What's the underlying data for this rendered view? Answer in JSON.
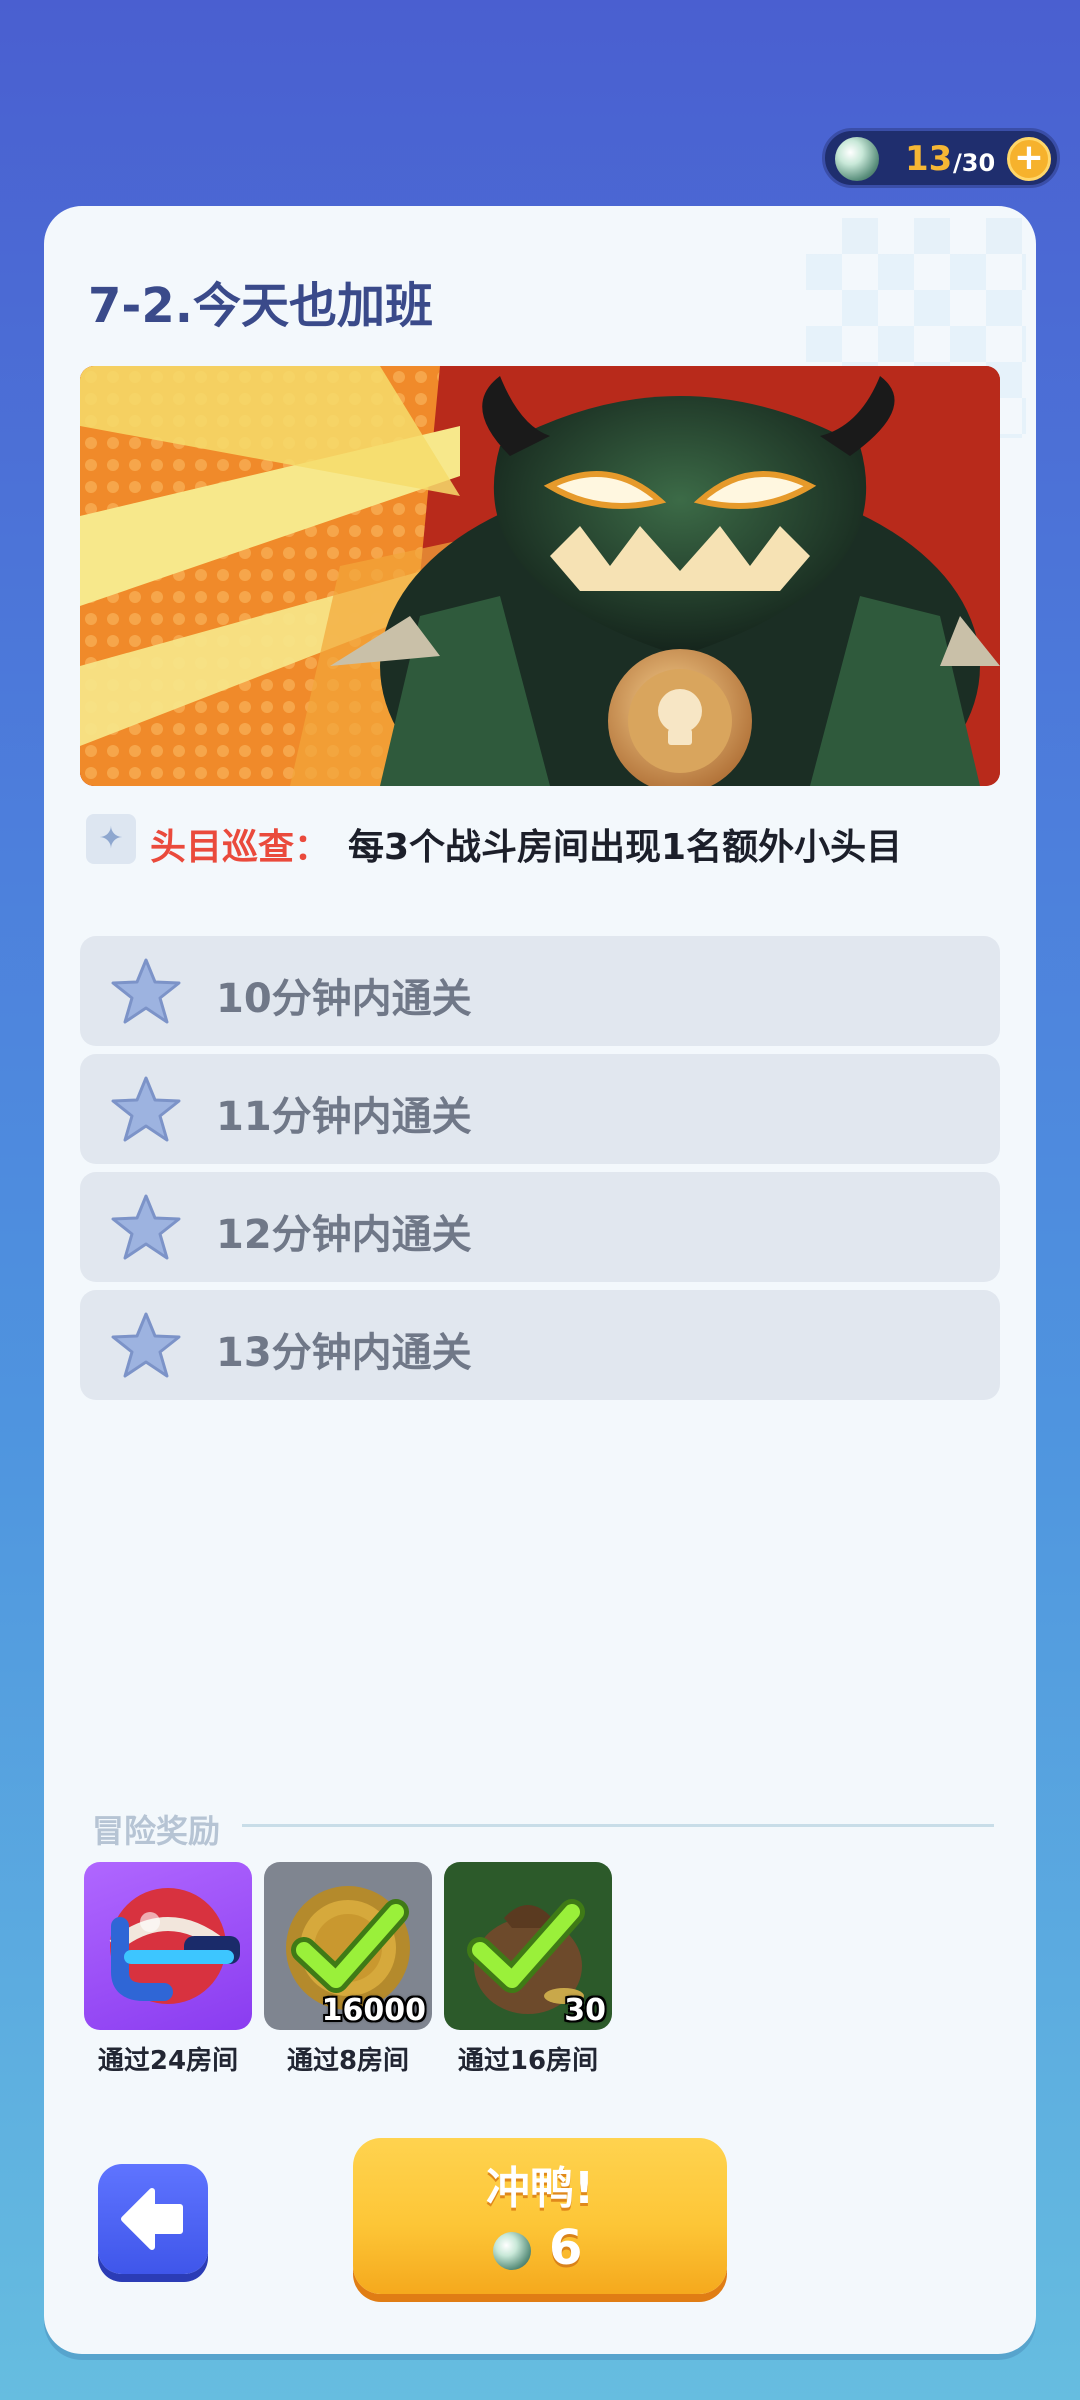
{
  "energy": {
    "current": "13",
    "max": "/30",
    "add_icon": "plus-icon",
    "orb_icon": "energy-orb-icon"
  },
  "level": {
    "title": "7-2.今天也加班"
  },
  "modifier": {
    "icon": "sparkle-icon",
    "name": "头目巡查：",
    "description": "每3个战斗房间出现1名额外小头目"
  },
  "objectives": [
    {
      "label": "10分钟内通关",
      "icon": "star-icon"
    },
    {
      "label": "11分钟内通关",
      "icon": "star-icon"
    },
    {
      "label": "12分钟内通关",
      "icon": "star-icon"
    },
    {
      "label": "13分钟内通关",
      "icon": "star-icon"
    }
  ],
  "rewards": {
    "header": "冒险奖励",
    "items": [
      {
        "label": "通过24房间",
        "amount": "",
        "claimed": false,
        "icon": "magnet-ball-icon"
      },
      {
        "label": "通过8房间",
        "amount": "16000",
        "claimed": true,
        "icon": "coin-icon"
      },
      {
        "label": "通过16房间",
        "amount": "30",
        "claimed": true,
        "icon": "money-bag-icon"
      }
    ]
  },
  "actions": {
    "back_icon": "arrow-left-icon",
    "go_label": "冲鸭!",
    "go_cost": "6"
  },
  "colors": {
    "accent_red": "#ea4a3c",
    "gold": "#f6b735",
    "button_blue": "#3f56ea",
    "button_yellow": "#fdc637",
    "check_green": "#9af03a"
  }
}
